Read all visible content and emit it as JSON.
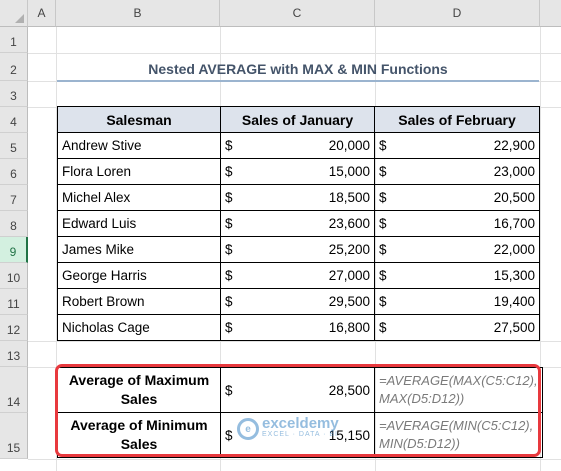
{
  "columns": [
    "A",
    "B",
    "C",
    "D"
  ],
  "rows": [
    "1",
    "2",
    "3",
    "4",
    "5",
    "6",
    "7",
    "8",
    "9",
    "10",
    "11",
    "12",
    "13",
    "14",
    "15"
  ],
  "title": "Nested AVERAGE with MAX & MIN Functions",
  "table": {
    "headers": [
      "Salesman",
      "Sales of January",
      "Sales of February"
    ],
    "currency": "$",
    "rows": [
      {
        "name": "Andrew Stive",
        "jan": "20,000",
        "feb": "22,900"
      },
      {
        "name": "Flora Loren",
        "jan": "15,000",
        "feb": "23,000"
      },
      {
        "name": "Michel Alex",
        "jan": "18,500",
        "feb": "20,500"
      },
      {
        "name": "Edward Luis",
        "jan": "23,600",
        "feb": "16,700"
      },
      {
        "name": "James Mike",
        "jan": "25,200",
        "feb": "22,000"
      },
      {
        "name": "George Harris",
        "jan": "27,000",
        "feb": "15,300"
      },
      {
        "name": "Robert Brown",
        "jan": "29,500",
        "feb": "19,400"
      },
      {
        "name": "Nicholas Cage",
        "jan": "16,800",
        "feb": "27,500"
      }
    ]
  },
  "summary": [
    {
      "label_line1": "Average of Maximum",
      "label_line2": "Sales",
      "value": "28,500",
      "formula_line1": "=AVERAGE(MAX(C5:C12),",
      "formula_line2": "MAX(D5:D12))"
    },
    {
      "label_line1": "Average of Minimum",
      "label_line2": "Sales",
      "value": "15,150",
      "formula_line1": "=AVERAGE(MIN(C5:C12),",
      "formula_line2": "MIN(D5:D12))"
    }
  ],
  "watermark": {
    "brand": "exceldemy",
    "tagline": "EXCEL · DATA · BI"
  }
}
